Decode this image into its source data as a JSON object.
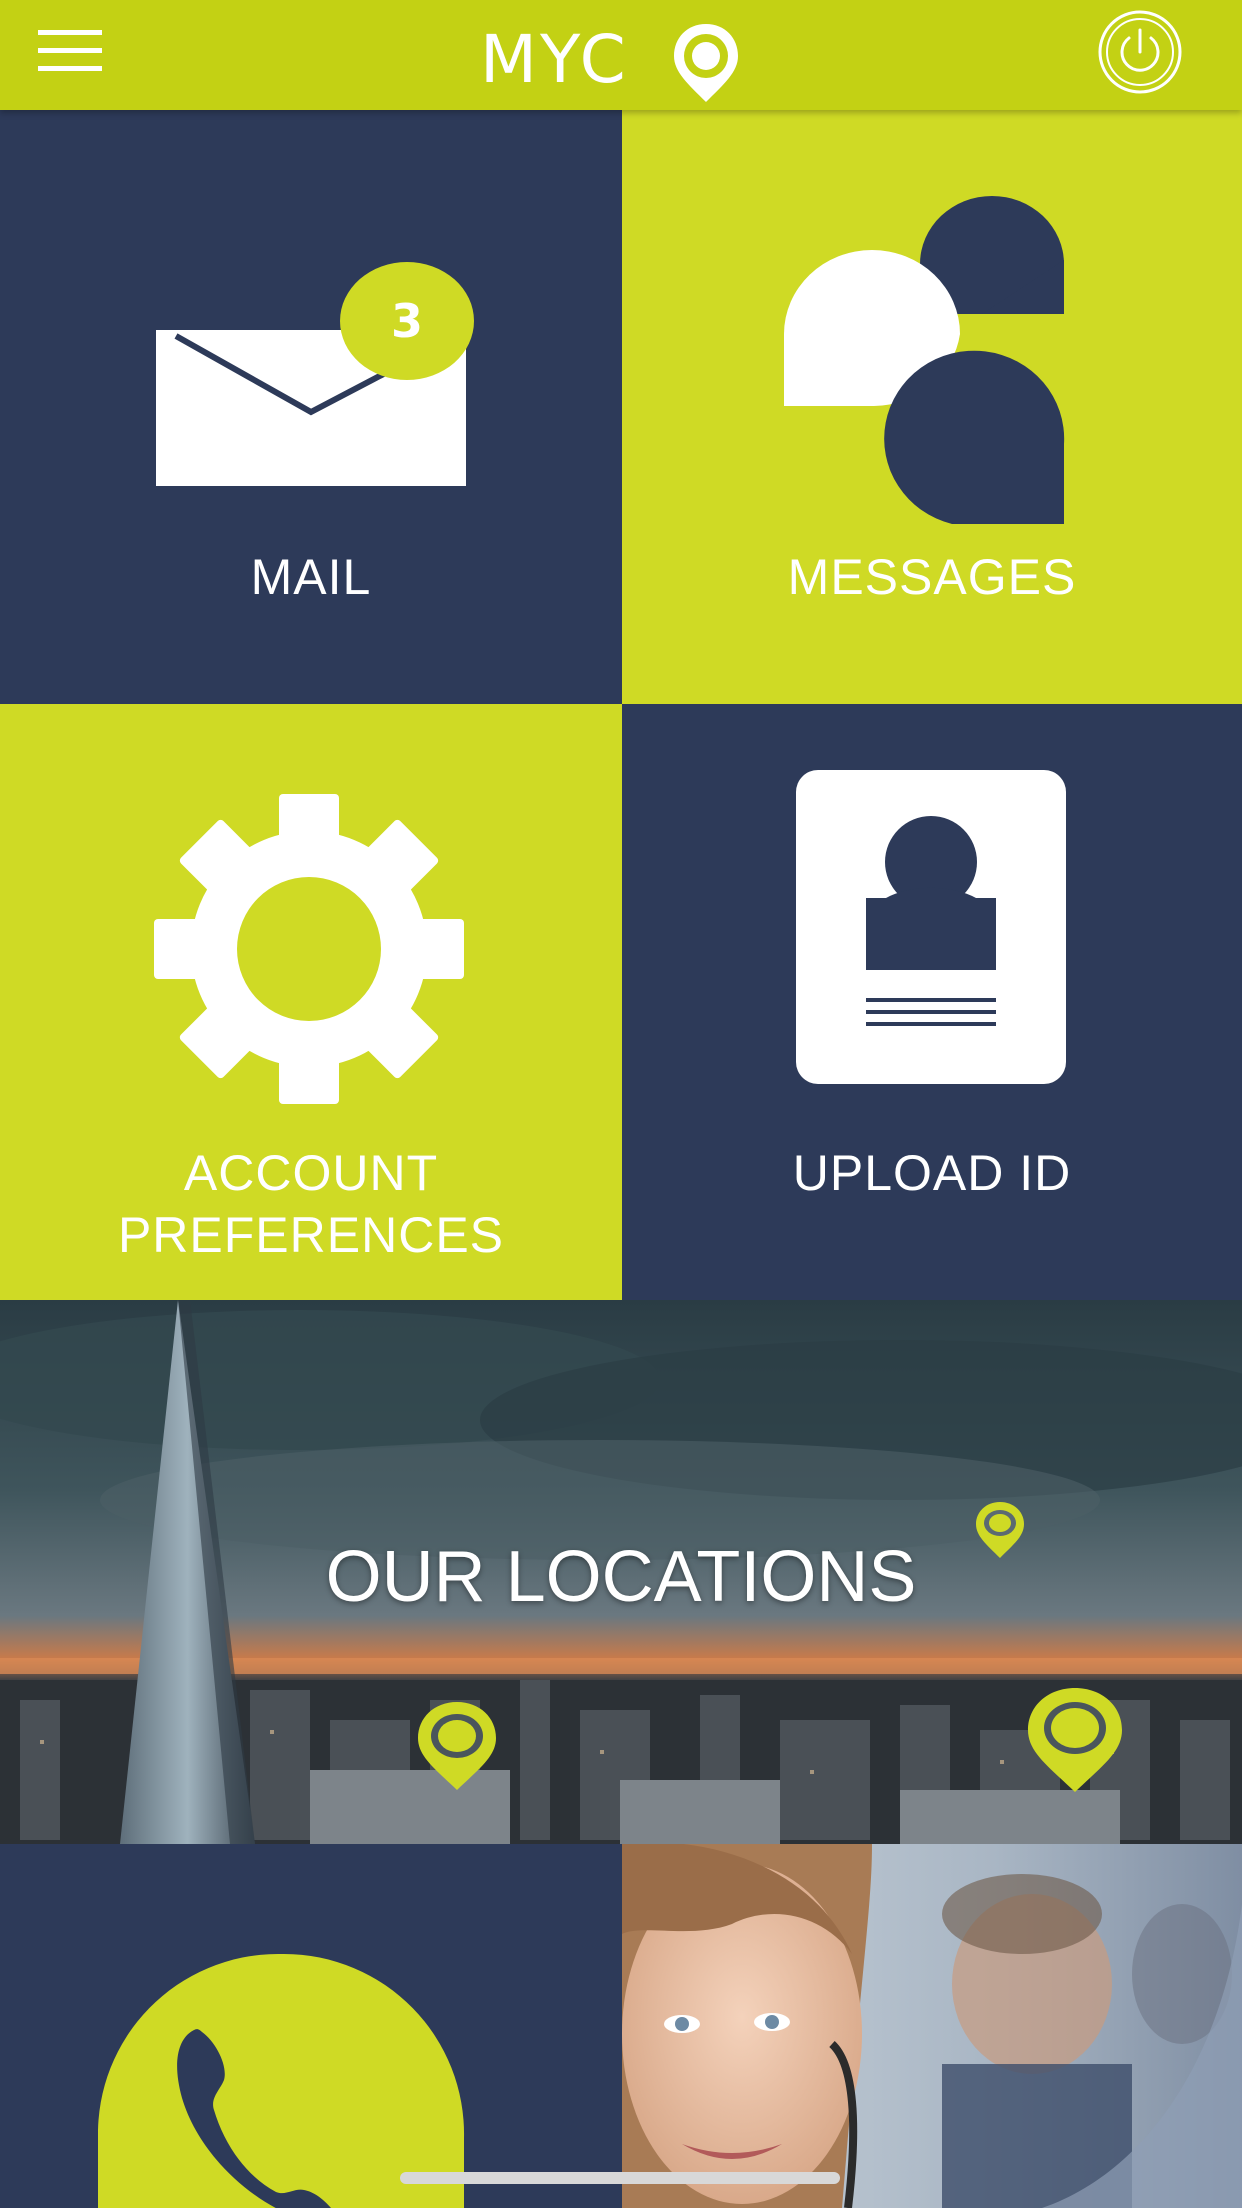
{
  "header": {
    "logo_text": "MYC",
    "menu_icon": "hamburger-menu-icon",
    "power_icon": "power-icon"
  },
  "tiles": {
    "mail": {
      "label": "MAIL",
      "badge": "3",
      "icon": "envelope-icon"
    },
    "messages": {
      "label": "MESSAGES",
      "icon": "chat-bubbles-icon"
    },
    "account": {
      "label_line1": "ACCOUNT",
      "label_line2": "PREFERENCES",
      "icon": "gear-icon"
    },
    "upload": {
      "label": "UPLOAD ID",
      "icon": "id-card-icon"
    }
  },
  "locations": {
    "label": "OUR LOCATIONS",
    "pin_icon": "location-pin-icon"
  },
  "bottom": {
    "phone_icon": "phone-icon"
  },
  "colors": {
    "lime": "#cfda25",
    "header_lime": "#c3d114",
    "navy": "#2d3a59",
    "white": "#ffffff"
  }
}
